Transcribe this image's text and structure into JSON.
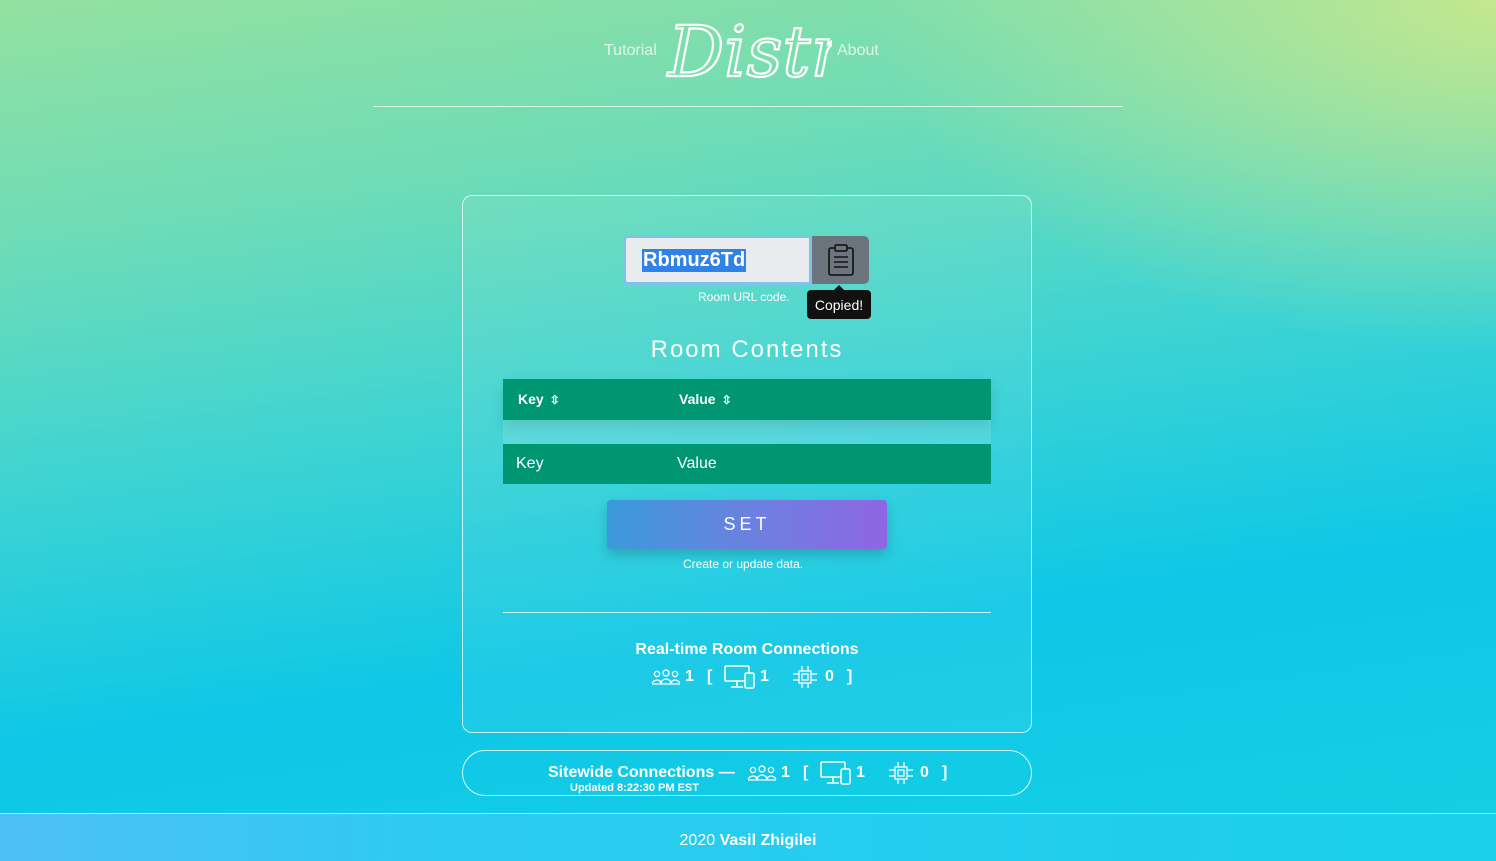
{
  "nav": {
    "tutorial_label": "Tutorial",
    "about_label": "About",
    "logo_text": "Distri"
  },
  "room": {
    "code_value": "Rbmuz6Td",
    "code_hint": "Room URL code.",
    "copy_icon": "clipboard-icon",
    "copied_tooltip": "Copied!",
    "contents_title": "Room Contents",
    "table": {
      "columns": [
        "Key",
        "Value"
      ],
      "sort_icon": "sort-icon",
      "rows": [],
      "key_placeholder": "Key",
      "value_placeholder": "Value"
    },
    "set_button": "SET",
    "set_hint": "Create or update data."
  },
  "room_connections": {
    "title": "Real-time Room Connections",
    "users": "1",
    "devices": "1",
    "bots": "0"
  },
  "sitewide": {
    "title": "Sitewide Connections —",
    "updated": "Updated 8:22:30 PM EST",
    "users": "1",
    "devices": "1",
    "bots": "0"
  },
  "footer": {
    "year": "2020",
    "author": "Vasil Zhigilei"
  },
  "colors": {
    "table_green": "#009672",
    "copy_button_gray": "#6c757d",
    "set_gradient_start": "#3a9ad9",
    "set_gradient_end": "#8f65e3"
  }
}
